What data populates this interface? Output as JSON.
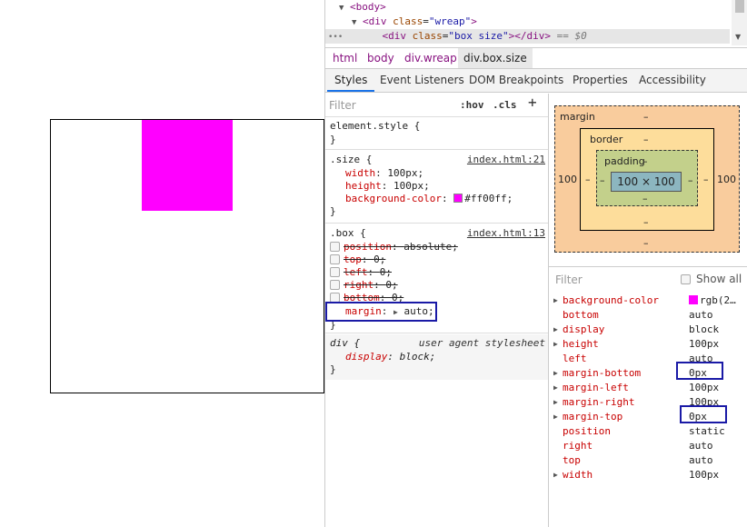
{
  "dom": {
    "line1_tag": "<body>",
    "line2_open": "<div",
    "line2_attr": "class",
    "line2_val": "\"wreap\"",
    "line2_close": ">",
    "line3_open": "<div",
    "line3_attr": "class",
    "line3_val": "\"box size\"",
    "line3_close": "></div>",
    "line3_eq": "== $0",
    "ellipsis": "•••"
  },
  "breadcrumbs": [
    "html",
    "body",
    "div.wreap",
    "div.box.size"
  ],
  "tabs": [
    "Styles",
    "Event Listeners",
    "DOM Breakpoints",
    "Properties",
    "Accessibility"
  ],
  "styles": {
    "filter_placeholder": "Filter",
    "hov": ":hov",
    "cls": ".cls",
    "plus": "+",
    "element_style": "element.style {",
    "close_brace": "}",
    "size_rule": {
      "selector": ".size {",
      "source": "index.html:21",
      "props": [
        {
          "name": "width",
          "value": "100px;"
        },
        {
          "name": "height",
          "value": "100px;"
        },
        {
          "name": "background-color",
          "value": "#ff00ff;"
        }
      ]
    },
    "box_rule": {
      "selector": ".box {",
      "source": "index.html:13",
      "props": [
        {
          "name": "position",
          "value": "absolute;"
        },
        {
          "name": "top",
          "value": "0;"
        },
        {
          "name": "left",
          "value": "0;"
        },
        {
          "name": "right",
          "value": "0;"
        },
        {
          "name": "bottom",
          "value": "0;"
        },
        {
          "name": "margin",
          "value": "auto;"
        }
      ]
    },
    "ua_rule": {
      "selector": "div {",
      "source": "user agent stylesheet",
      "prop_name": "display",
      "prop_value": "block;"
    }
  },
  "boxmodel": {
    "margin_label": "margin",
    "border_label": "border",
    "padding_label": "padding",
    "dash": "–",
    "content": "100 × 100",
    "margin_left": "100",
    "margin_right": "100"
  },
  "computed": {
    "filter": "Filter",
    "show_all": "Show all",
    "rows": [
      {
        "name": "background-color",
        "value": "rgb(2…",
        "expandable": true,
        "swatch": true
      },
      {
        "name": "bottom",
        "value": "auto",
        "expandable": false
      },
      {
        "name": "display",
        "value": "block",
        "expandable": true
      },
      {
        "name": "height",
        "value": "100px",
        "expandable": true
      },
      {
        "name": "left",
        "value": "auto",
        "expandable": false
      },
      {
        "name": "margin-bottom",
        "value": "0px",
        "expandable": true
      },
      {
        "name": "margin-left",
        "value": "100px",
        "expandable": true
      },
      {
        "name": "margin-right",
        "value": "100px",
        "expandable": true
      },
      {
        "name": "margin-top",
        "value": "0px",
        "expandable": true
      },
      {
        "name": "position",
        "value": "static",
        "expandable": false
      },
      {
        "name": "right",
        "value": "auto",
        "expandable": false
      },
      {
        "name": "top",
        "value": "auto",
        "expandable": false
      },
      {
        "name": "width",
        "value": "100px",
        "expandable": true
      }
    ]
  },
  "colors": {
    "box_fill": "#ff00ff",
    "highlight": "#1a1aa6",
    "tab_accent": "#1a73e8"
  }
}
